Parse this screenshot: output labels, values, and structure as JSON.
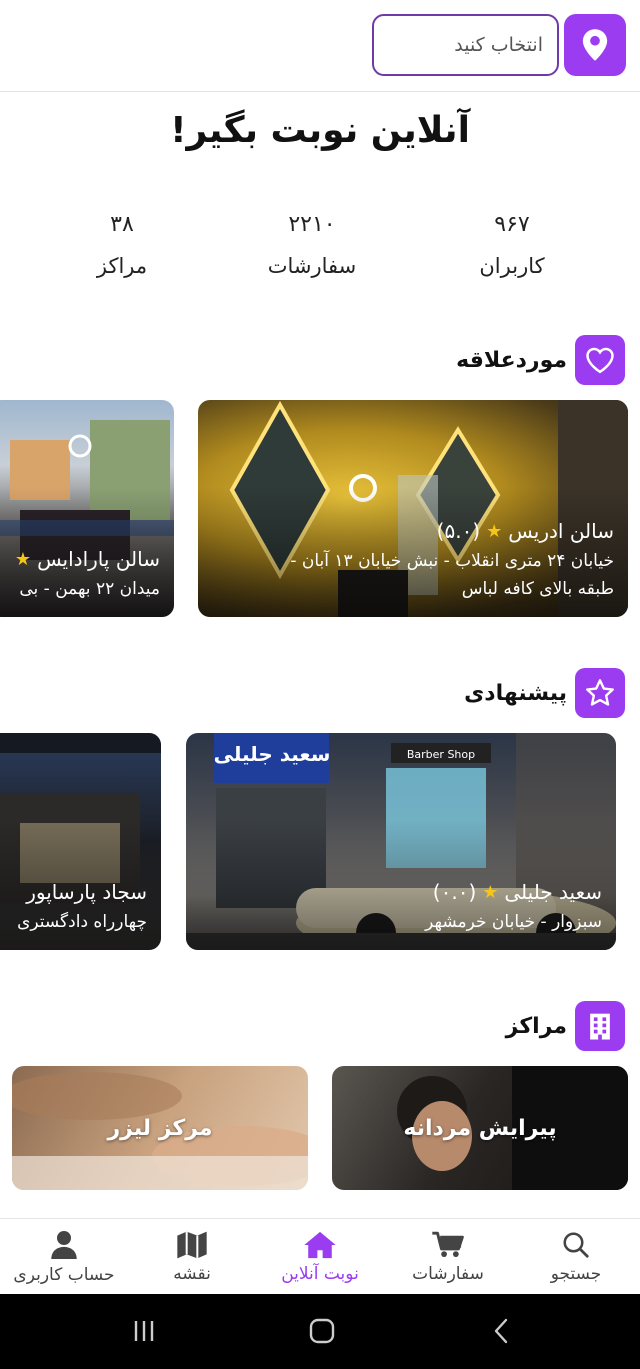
{
  "header": {
    "location_placeholder": "انتخاب کنید",
    "location_icon": "location-pin-icon"
  },
  "hero": {
    "title": "آنلاین نوبت بگیر!"
  },
  "stats": [
    {
      "value": "۹۶۷",
      "label": "کاربران"
    },
    {
      "value": "۲۲۱۰",
      "label": "سفارشات"
    },
    {
      "value": "۳۸",
      "label": "مراکز"
    }
  ],
  "favorites": {
    "title": "موردعلاقه",
    "icon": "heart-icon",
    "cards": [
      {
        "name": "سالن ادریس",
        "rating": "(۵.۰)",
        "address": "خیابان ۲۴ متری انقلاب - نبش خیابان ۱۳ آبان -",
        "address2": "طبقه بالای کافه لباس"
      },
      {
        "name": "سالن پارادایس",
        "rating": "",
        "address": "میدان ۲۲ بهمن - بی",
        "address2": ""
      }
    ]
  },
  "suggested": {
    "title": "پیشنهادی",
    "icon": "star-icon",
    "cards": [
      {
        "name": "سعید جلیلی",
        "rating": "(۰.۰)",
        "address": "سبزوار - خیابان خرمشهر",
        "sign": "سعید جلیلی",
        "shop": "Barber Shop"
      },
      {
        "name": "سجاد پارساپور",
        "rating": "",
        "address": "چهارراه دادگستری"
      }
    ]
  },
  "centers": {
    "title": "مراکز",
    "icon": "building-icon",
    "items": [
      {
        "label": "پیرایش مردانه"
      },
      {
        "label": "مرکز لیزر"
      }
    ]
  },
  "bottom_nav": [
    {
      "label": "جستجو",
      "icon": "search-icon",
      "active": false
    },
    {
      "label": "سفارشات",
      "icon": "cart-icon",
      "active": false
    },
    {
      "label": "نوبت آنلاین",
      "icon": "home-icon",
      "active": true
    },
    {
      "label": "نقشه",
      "icon": "map-icon",
      "active": false
    },
    {
      "label": "حساب کاربری",
      "icon": "user-icon",
      "active": false
    }
  ],
  "colors": {
    "accent": "#9b3cf0",
    "input_border": "#6e3aa8",
    "star": "#f5c518"
  }
}
